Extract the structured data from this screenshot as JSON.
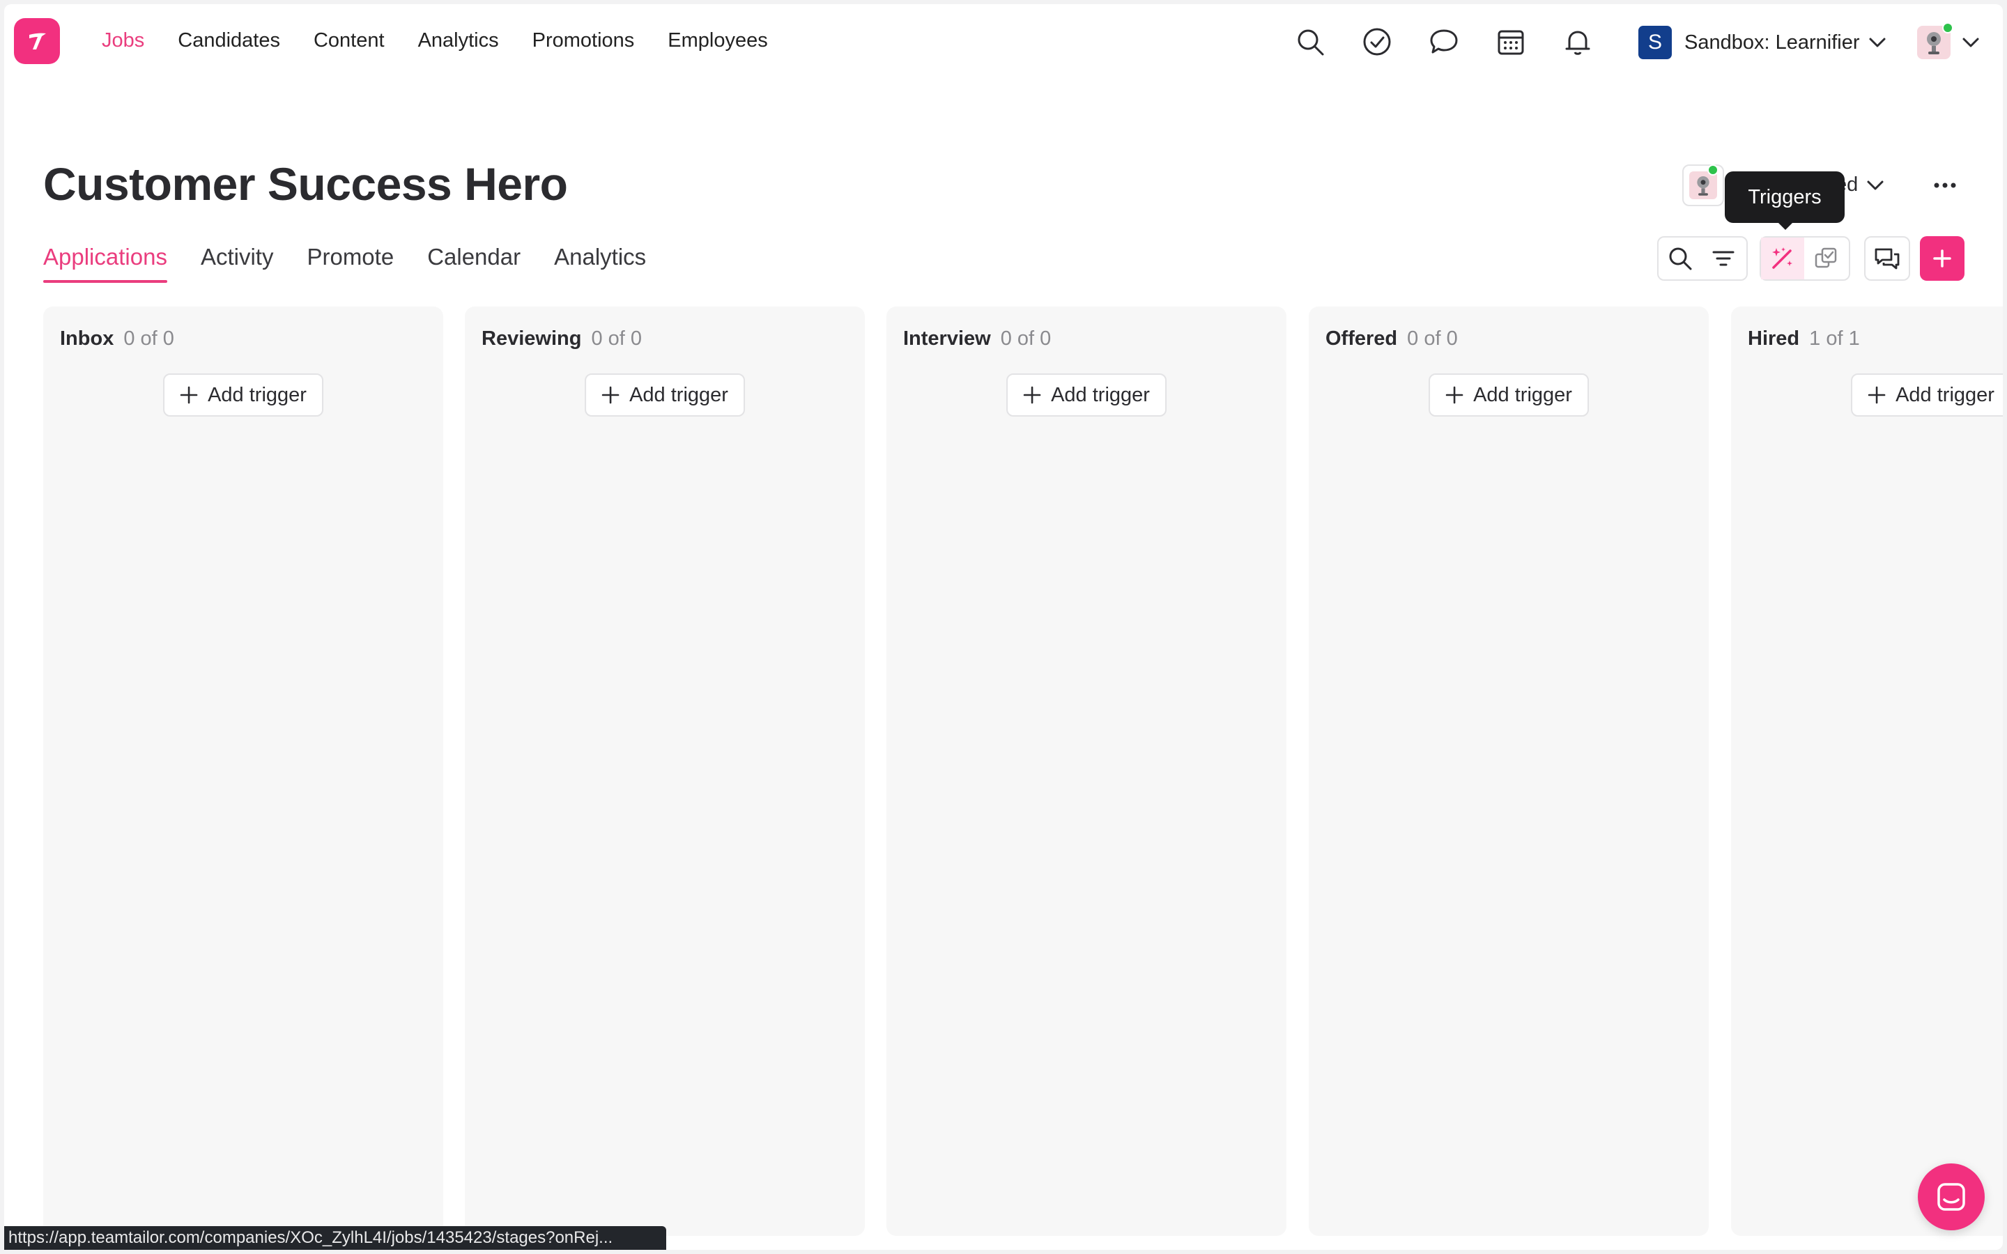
{
  "app": {
    "logo_icon": "teamtailor-logo-icon",
    "brand_color": "#f2307f",
    "accent_text_color": "#ea3d7e"
  },
  "topnav": {
    "items": [
      {
        "label": "Jobs",
        "active": true
      },
      {
        "label": "Candidates",
        "active": false
      },
      {
        "label": "Content",
        "active": false
      },
      {
        "label": "Analytics",
        "active": false
      },
      {
        "label": "Promotions",
        "active": false
      },
      {
        "label": "Employees",
        "active": false
      }
    ],
    "icons": [
      "search-icon",
      "todo-check-icon",
      "messages-icon",
      "calendar-icon",
      "notifications-bell-icon"
    ],
    "workspace": {
      "badge": "S",
      "label": "Sandbox: Learnifier"
    }
  },
  "job": {
    "title": "Customer Success Hero",
    "status_partial": "ed"
  },
  "tooltip": {
    "text": "Triggers"
  },
  "tabs": [
    {
      "label": "Applications",
      "active": true
    },
    {
      "label": "Activity",
      "active": false
    },
    {
      "label": "Promote",
      "active": false
    },
    {
      "label": "Calendar",
      "active": false
    },
    {
      "label": "Analytics",
      "active": false
    }
  ],
  "toolbar": {
    "icons": [
      "search-icon",
      "filter-icon",
      "triggers-magic-wand-icon",
      "bulk-select-icon",
      "chat-bubbles-icon",
      "add-icon"
    ]
  },
  "stages": [
    {
      "name": "Inbox",
      "count": "0 of 0",
      "add_label": "Add trigger"
    },
    {
      "name": "Reviewing",
      "count": "0 of 0",
      "add_label": "Add trigger"
    },
    {
      "name": "Interview",
      "count": "0 of 0",
      "add_label": "Add trigger"
    },
    {
      "name": "Offered",
      "count": "0 of 0",
      "add_label": "Add trigger"
    },
    {
      "name": "Hired",
      "count": "1 of 1",
      "add_label": "Add trigger"
    }
  ],
  "statusbar": {
    "url": "https://app.teamtailor.com/companies/XOc_ZylhL4I/jobs/1435423/stages?onRej..."
  }
}
